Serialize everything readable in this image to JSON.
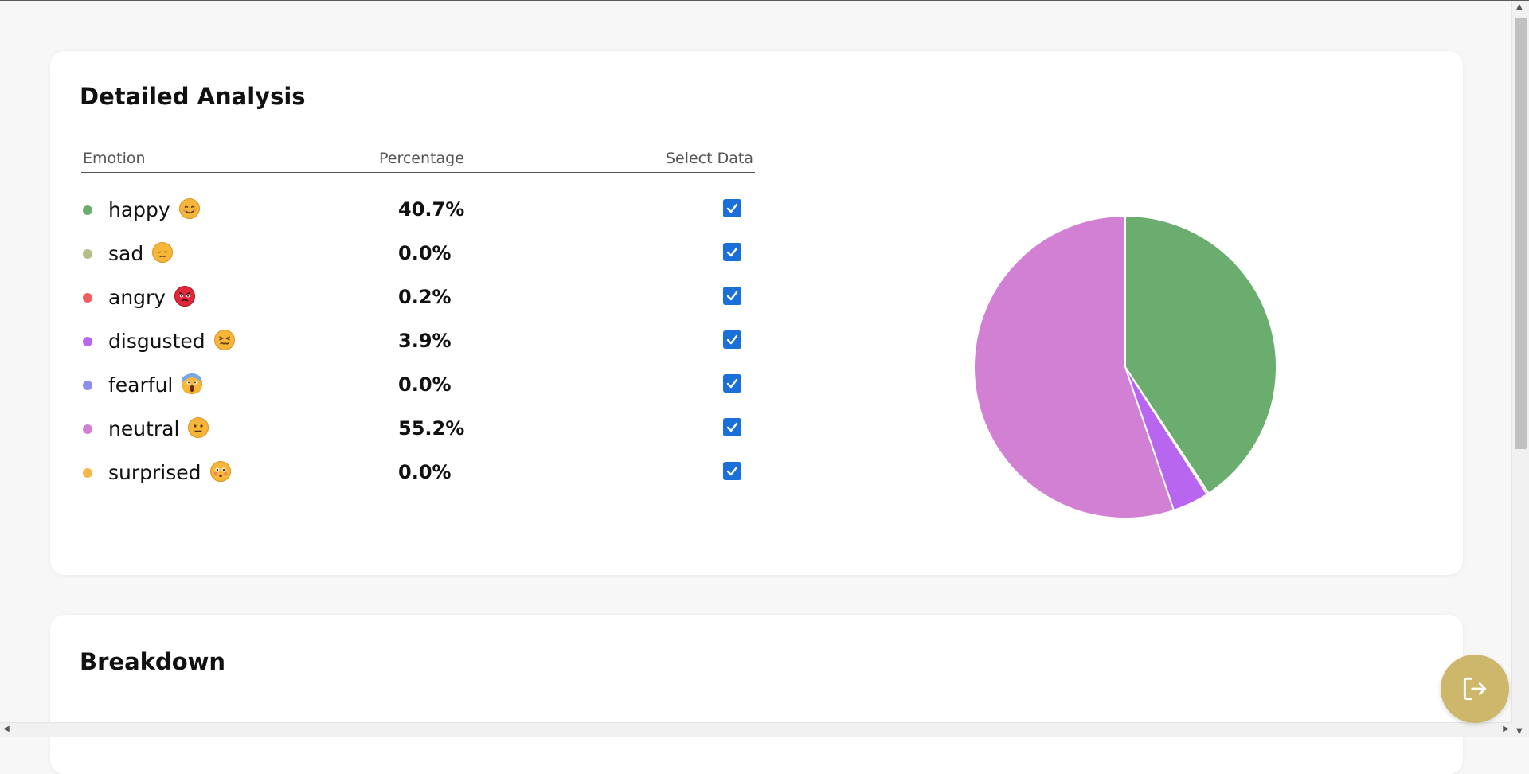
{
  "analysis": {
    "title": "Detailed Analysis",
    "columns": {
      "emotion": "Emotion",
      "percentage": "Percentage",
      "select": "Select Data"
    },
    "rows": [
      {
        "label": "happy",
        "percent": "40.7%",
        "color": "#6aad6e",
        "emoji_icon": "smiling-face-icon",
        "checked": true
      },
      {
        "label": "sad",
        "percent": "0.0%",
        "color": "#b7bd87",
        "emoji_icon": "pensive-face-icon",
        "checked": true
      },
      {
        "label": "angry",
        "percent": "0.2%",
        "color": "#ef5f5f",
        "emoji_icon": "angry-face-icon",
        "checked": true
      },
      {
        "label": "disgusted",
        "percent": "3.9%",
        "color": "#b865ef",
        "emoji_icon": "confounded-face-icon",
        "checked": true
      },
      {
        "label": "fearful",
        "percent": "0.0%",
        "color": "#8f8ef0",
        "emoji_icon": "screaming-face-icon",
        "checked": true
      },
      {
        "label": "neutral",
        "percent": "55.2%",
        "color": "#d180d4",
        "emoji_icon": "neutral-face-icon",
        "checked": true
      },
      {
        "label": "surprised",
        "percent": "0.0%",
        "color": "#f7b84a",
        "emoji_icon": "flushed-face-icon",
        "checked": true
      }
    ]
  },
  "chart_data": {
    "type": "pie",
    "categories": [
      "happy",
      "sad",
      "angry",
      "disgusted",
      "fearful",
      "neutral",
      "surprised"
    ],
    "values": [
      40.7,
      0.0,
      0.2,
      3.9,
      0.0,
      55.2,
      0.0
    ],
    "colors": [
      "#6aad6e",
      "#b7bd87",
      "#ef5f5f",
      "#b865ef",
      "#8f8ef0",
      "#d180d4",
      "#f7b84a"
    ],
    "slice_border_color": "#ffffff",
    "start_direction": "top, clockwise",
    "title": "",
    "legend": "none"
  },
  "breakdown": {
    "title": "Breakdown"
  },
  "fab": {
    "icon": "logout-icon",
    "color": "#cdb76a"
  },
  "colors": {
    "checkbox": "#1a6fd8",
    "background": "#f7f7f7",
    "card": "#ffffff"
  }
}
